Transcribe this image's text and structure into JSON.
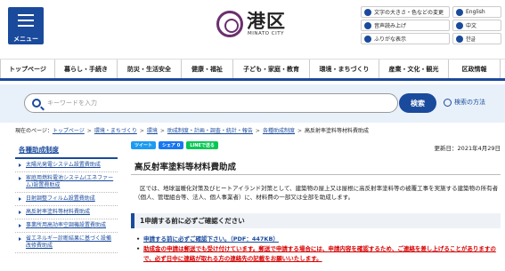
{
  "header": {
    "menu_label": "メニュー",
    "logo_name": "港区",
    "logo_sub": "MINATO CITY",
    "tools": [
      {
        "label": "文字の大きさ・色などの変更",
        "icon": "text-size-icon"
      },
      {
        "label": "音声読み上げ",
        "icon": "speaker-icon"
      },
      {
        "label": "ふりがな表示",
        "icon": "furigana-icon"
      }
    ],
    "languages": [
      {
        "label": "English",
        "icon": "globe-icon"
      },
      {
        "label": "中文",
        "icon": "globe-icon"
      },
      {
        "label": "한글",
        "icon": "globe-icon"
      }
    ]
  },
  "nav": {
    "items": [
      "トップページ",
      "暮らし・手続き",
      "防災・生活安全",
      "健康・福祉",
      "子ども・家庭・教育",
      "環境・まちづくり",
      "産業・文化・観光",
      "区政情報"
    ]
  },
  "search": {
    "placeholder": "キーワードを入力",
    "button_label": "検索",
    "help_label": "検索の方法"
  },
  "breadcrumb": {
    "prefix": "現在のページ：",
    "links": [
      "トップページ",
      "環境・まちづくり",
      "環境",
      "助成制度・計画・調査・統計・報告",
      "各種助成制度"
    ],
    "current": "高反射率塗料等材料費助成"
  },
  "sidebar": {
    "title": "各種助成制度",
    "items": [
      "太陽光発電システム設置費助成",
      "家庭用燃料電池システム(エネファーム)設置費助成",
      "日射調整フィルム設置費助成",
      "高反射率塗料等材料費助成",
      "事業所用高効率空調機設置費助成",
      "省エネルギー診断結果に基づく設備改修費助成"
    ]
  },
  "main": {
    "share": {
      "tweet": "ツイート",
      "facebook": "シェア 0",
      "line": "LINEで送る"
    },
    "updated": "更新日：2021年4月29日",
    "title": "高反射率塗料等材料費助成",
    "intro": "区では、地球温暖化対策及びヒートアイランド対策として、建築物の屋上又は屋根に高反射率塗料等の被覆工事を実施する建築物の所有者（個人、管理組合等、法人、個人事業者）に、材料費の一部又は全部を助成します。",
    "subheading": "1申請する前に必ずご確認ください",
    "bullet_link": "申請する前に必ずご確認下さい。（PDF：447KB）",
    "bullet_notice": "助成金の申請は郵送でも受け付けています。郵送で申請する場合には、申請内容を確認するため、ご連絡を差し上げることがありますので、必ず日中に連絡が取れる方の連絡先の記載をお願いいたします。"
  },
  "colors": {
    "primary": "#1a4a9c",
    "logo": "#6b2f6e",
    "notice_red": "#d60000",
    "search_band": "#e8f1fa"
  }
}
